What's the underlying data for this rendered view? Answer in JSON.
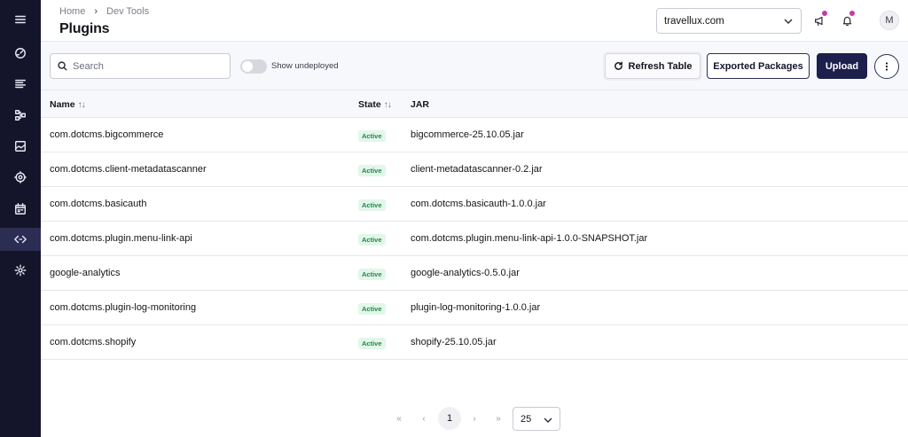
{
  "sidebar": {
    "items": [
      {
        "icon": "menu-icon"
      },
      {
        "icon": "dashboard-icon"
      },
      {
        "icon": "content-icon"
      },
      {
        "icon": "structure-icon"
      },
      {
        "icon": "media-icon"
      },
      {
        "icon": "experiments-icon"
      },
      {
        "icon": "calendar-icon"
      },
      {
        "icon": "dev-tools-icon",
        "active": true
      },
      {
        "icon": "settings-icon"
      }
    ]
  },
  "header": {
    "breadcrumb": [
      "Home",
      "Dev Tools"
    ],
    "title": "Plugins",
    "site": "travellux.com",
    "avatar_initial": "M",
    "notification_dot_color": "#c53aa3"
  },
  "toolbar": {
    "search_placeholder": "Search",
    "toggle_label": "Show undeployed",
    "refresh_label": "Refresh Table",
    "exported_label": "Exported Packages",
    "upload_label": "Upload"
  },
  "table": {
    "columns": {
      "name": "Name",
      "state": "State",
      "jar": "JAR"
    },
    "rows": [
      {
        "name": "com.dotcms.bigcommerce",
        "state": "Active",
        "jar": "bigcommerce-25.10.05.jar"
      },
      {
        "name": "com.dotcms.client-metadatascanner",
        "state": "Active",
        "jar": "client-metadatascanner-0.2.jar"
      },
      {
        "name": "com.dotcms.basicauth",
        "state": "Active",
        "jar": "com.dotcms.basicauth-1.0.0.jar"
      },
      {
        "name": "com.dotcms.plugin.menu-link-api",
        "state": "Active",
        "jar": "com.dotcms.plugin.menu-link-api-1.0.0-SNAPSHOT.jar"
      },
      {
        "name": "google-analytics",
        "state": "Active",
        "jar": "google-analytics-0.5.0.jar"
      },
      {
        "name": "com.dotcms.plugin-log-monitoring",
        "state": "Active",
        "jar": "plugin-log-monitoring-1.0.0.jar"
      },
      {
        "name": "com.dotcms.shopify",
        "state": "Active",
        "jar": "shopify-25.10.05.jar"
      }
    ]
  },
  "pagination": {
    "current_page": "1",
    "per_page": "25"
  },
  "colors": {
    "sidebar": "#14152b",
    "primary": "#1d1f4d",
    "badge_bg": "#e3f6ea",
    "badge_text": "#1f8a47"
  }
}
